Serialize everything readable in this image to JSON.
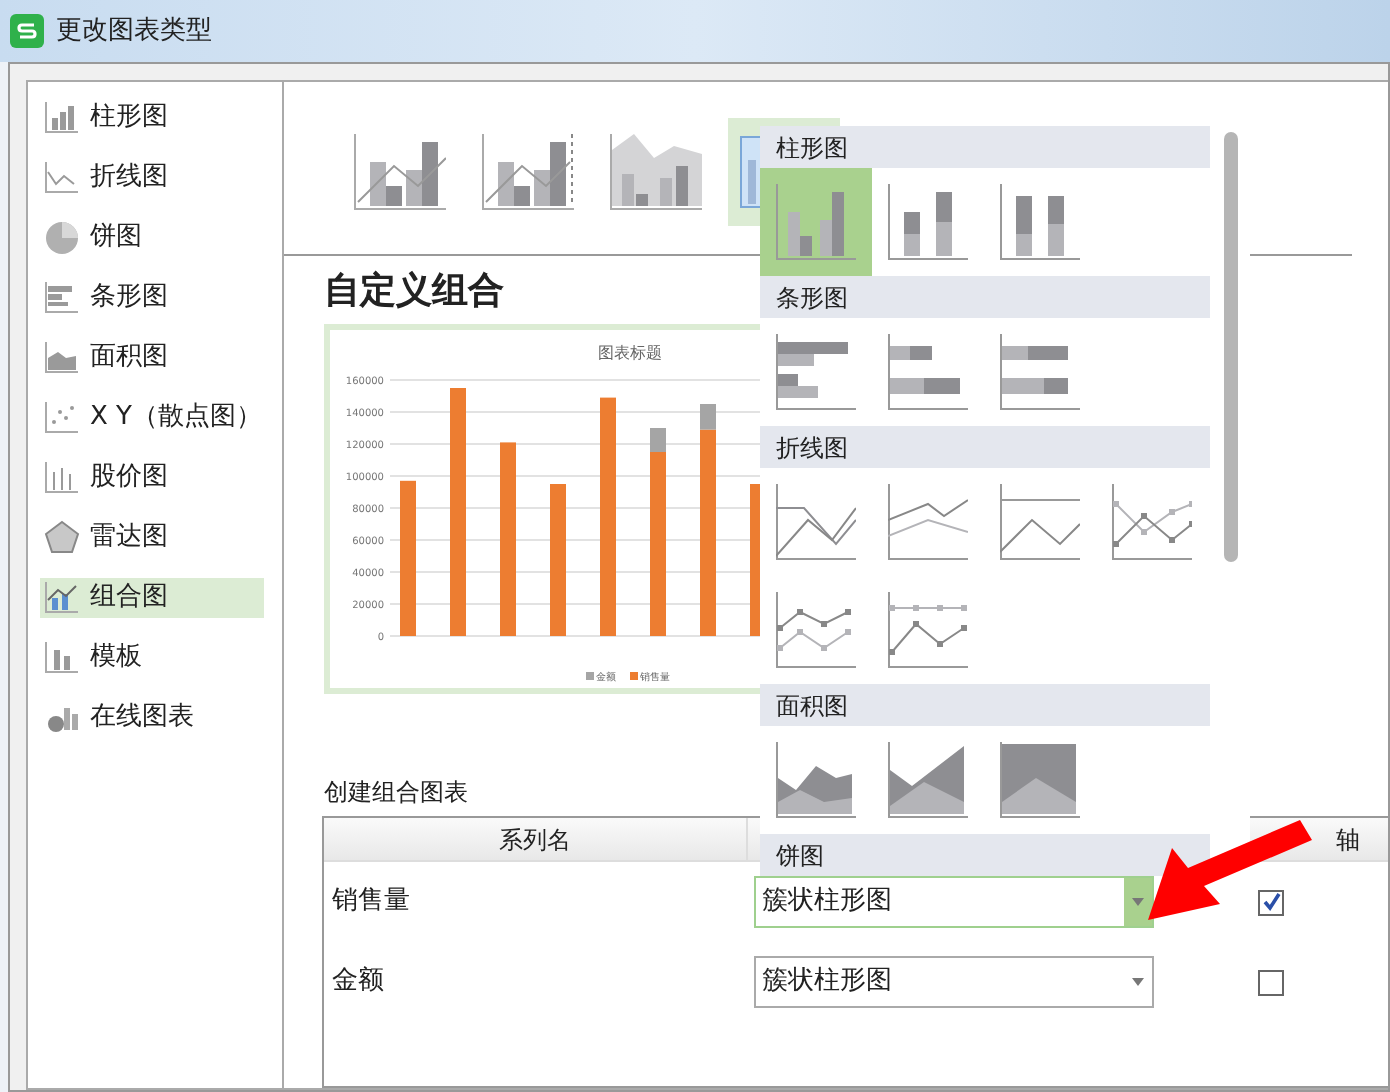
{
  "window": {
    "title": "更改图表类型"
  },
  "sidebar": {
    "items": [
      {
        "label": "柱形图",
        "kind": "column",
        "selected": false
      },
      {
        "label": "折线图",
        "kind": "line",
        "selected": false
      },
      {
        "label": "饼图",
        "kind": "pie",
        "selected": false
      },
      {
        "label": "条形图",
        "kind": "bar",
        "selected": false
      },
      {
        "label": "面积图",
        "kind": "area",
        "selected": false
      },
      {
        "label": "X Y（散点图）",
        "kind": "scatter",
        "selected": false
      },
      {
        "label": "股价图",
        "kind": "stock",
        "selected": false
      },
      {
        "label": "雷达图",
        "kind": "radar",
        "selected": false
      },
      {
        "label": "组合图",
        "kind": "combo",
        "selected": true
      },
      {
        "label": "模板",
        "kind": "template",
        "selected": false
      },
      {
        "label": "在线图表",
        "kind": "online",
        "selected": false
      }
    ]
  },
  "subtypes": [
    {
      "kind": "column-line",
      "selected": false
    },
    {
      "kind": "column-line-axis",
      "selected": false
    },
    {
      "kind": "area-column",
      "selected": false
    },
    {
      "kind": "custom",
      "selected": true
    }
  ],
  "heading": "自定义组合",
  "preview": {
    "chart_data": {
      "type": "bar",
      "title": "图表标题",
      "stacked": true,
      "grid": true,
      "legend": "bottom",
      "yticks": [
        0,
        20000,
        40000,
        60000,
        80000,
        100000,
        120000,
        140000,
        160000
      ],
      "ylim": [
        0,
        160000
      ],
      "series": [
        {
          "name": "销售量",
          "color": "#ed7d31",
          "values": [
            97000,
            155000,
            121000,
            95000,
            149000,
            115000,
            129000,
            95000
          ]
        },
        {
          "name": "金额",
          "color": "#a5a5a5",
          "values": [
            0,
            0,
            0,
            0,
            0,
            15000,
            16000,
            0
          ]
        }
      ]
    }
  },
  "popup": {
    "sections": [
      {
        "title": "柱形图",
        "options": [
          {
            "kind": "clustered-column",
            "selected": true
          },
          {
            "kind": "stacked-column",
            "selected": false
          },
          {
            "kind": "full-column",
            "selected": false
          }
        ]
      },
      {
        "title": "条形图",
        "options": [
          {
            "kind": "clustered-bar",
            "selected": false
          },
          {
            "kind": "stacked-bar",
            "selected": false
          },
          {
            "kind": "full-bar",
            "selected": false
          }
        ]
      },
      {
        "title": "折线图",
        "options": [
          {
            "kind": "line",
            "selected": false
          },
          {
            "kind": "stacked-line",
            "selected": false
          },
          {
            "kind": "full-line",
            "selected": false
          },
          {
            "kind": "marker-line",
            "selected": false
          },
          {
            "kind": "stacked-marker-line",
            "selected": false
          },
          {
            "kind": "full-marker-line",
            "selected": false
          }
        ]
      },
      {
        "title": "面积图",
        "options": [
          {
            "kind": "area",
            "selected": false
          },
          {
            "kind": "stacked-area",
            "selected": false
          },
          {
            "kind": "full-area",
            "selected": false
          }
        ]
      },
      {
        "title": "饼图"
      }
    ]
  },
  "combo_table": {
    "label": "创建组合图表",
    "columns": [
      "系列名",
      "轴"
    ],
    "rows": [
      {
        "name": "销售量",
        "chart_type": "簇状柱形图",
        "focused": true,
        "secondary_axis": true
      },
      {
        "name": "金额",
        "chart_type": "簇状柱形图",
        "focused": false,
        "secondary_axis": false
      }
    ]
  }
}
